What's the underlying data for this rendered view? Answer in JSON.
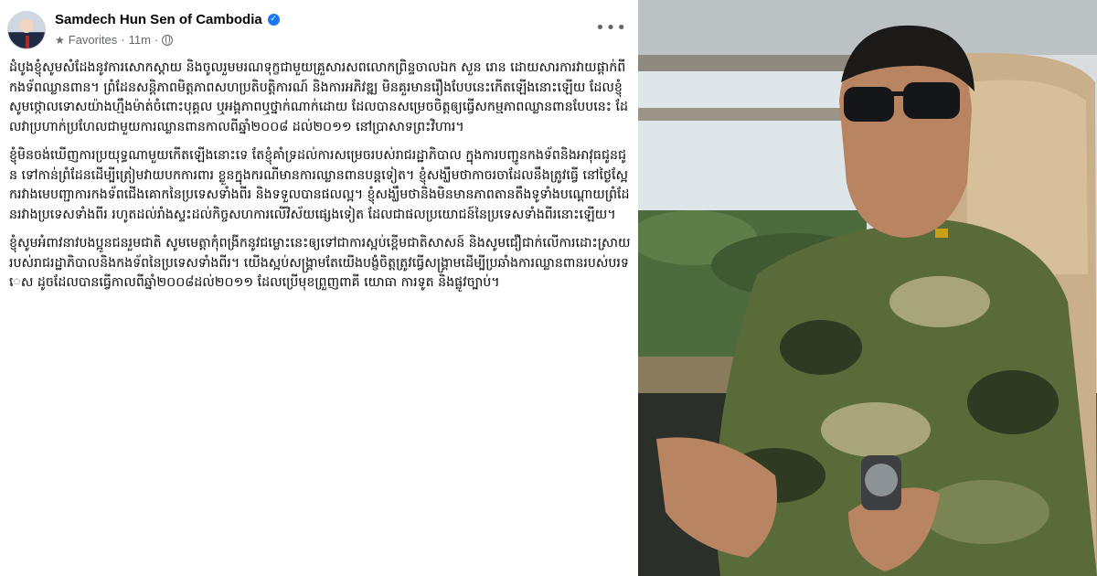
{
  "post": {
    "page_name": "Samdech Hun Sen of Cambodia",
    "audience_label": "Favorites",
    "separator": "·",
    "timestamp": "11m",
    "more_label": "•••",
    "verified_icon": "verified-badge-icon",
    "paragraphs": [
      "ដំបូងខ្ញុំសូមសំដែងនូវការសោកស្ដាយ និងចូលរួមមរណទុក្ខជាមួយគ្រួសារសពលោកព្រិន្ទចាលឯក សួន រោន ដោយសារការវាយផ្ដាក់ពីកងទ័ពឈ្លានពាន។ ព្រំដែនសន្តិភាពមិត្តភាពសហប្រតិបត្តិការណ៍ និងការអភិវឌ្ឍ មិនគួរមានរឿងបែបនេះកើតឡើងនោះឡើយ ដែលខ្ញុំសូមថ្កោលទោសយ៉ាងហ្មឹងម៉ាត់ចំពោះបុគ្គល ឬអង្គភាពឬថ្នាក់ណាក់ដោយ ដែលបានសម្រេចចិត្តឲ្យធ្វើសកម្មភាពឈ្លានពានបែបនេះ ដែលវាប្រហាក់ប្រហែលជាមួយការឈ្លានពានកាលពីឆ្នាំ២០០៨ ដល់២០១១ នៅប្រាសាទព្រះវិហារ។",
      "ខ្ញុំមិនចង់ឃើញការប្រយុទ្ធណាមួយកើតឡើងនោះទេ តែខ្ញុំគាំទ្រដល់ការសម្រេចរបស់រាជរដ្ឋាភិបាល ក្នុងការបញ្ជូនកងទ័ពនិងអាវុធជូនជូន ទៅកាន់ព្រំដែនដើម្បីត្រៀមវាយបកការពារ ខ្លួនក្នុងករណីមានការឈ្លានពានបន្តទៀត។ ខ្ញុំសង្ឃឹមថាកាចរចាដែលនឹងត្រូវធ្វើ នៅថ្ងៃស្អែករវាងមេបញ្ជាការកងទ័ពជើងគោកនៃប្រទេសទាំងពីរ និងទទួលបានផលល្អ។ ខ្ញុំសង្ឃឹមថានិងមិនមានភាពតានតឹងទូទាំងបណ្ដោយព្រំដែនរវាងប្រទេសទាំងពីរ រហូតដល់រាំងស្ទះដល់កិច្ចសហការលើវិស័យផ្សេងទៀត ដែលជាផលប្រយោជន៍នៃប្រទេសទាំងពីរនោះឡើយ។",
      "ខ្ញុំសូមអំពាវនាវបងប្អូនជនរួមជាតិ សូមមេត្តាកុំពង្រីកនូវជម្លោះនេះឲ្យទៅជាការស្អប់ខ្ពើមជាតិសាសន៍ និងសូមជឿជាក់លើការដោះស្រាយរបស់រាជរដ្ឋាភិបាលនិងកងទ័ពនៃប្រទេសទាំងពីរ។ យើងស្អប់សង្គ្រាមតែយើងបង្ខំចិត្តត្រូវធ្វើសង្គ្រាមដើម្បីប្រឆាំងការឈ្លានពានរបស់បរទេស ដូចដែលបានធ្វើកាលពីឆ្នាំ២០០៨ដល់២០១១ ដែលប្រើមុខព្រួញពាគី យោធា ការទូត និងផ្លូវច្បាប់។"
    ]
  },
  "photo": {
    "subject": "man-in-camouflage-uniform-photo",
    "colors": {
      "camo_dark": "#2e3a22",
      "camo_mid": "#5a6b3a",
      "camo_light": "#a8a57a",
      "seat": "#c9b08a",
      "window_sky": "#dfe6ea",
      "forest": "#4d6b3c"
    }
  },
  "colors": {
    "verified": "#1877f2",
    "meta_text": "#65676b",
    "text": "#050505"
  }
}
